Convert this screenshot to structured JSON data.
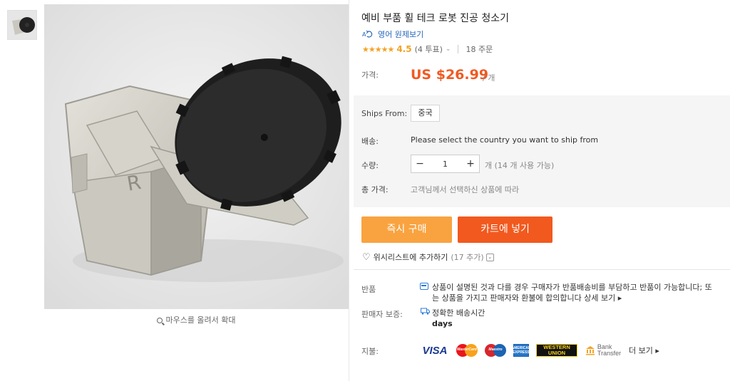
{
  "product": {
    "title": "예비 부품 휠 테크 로봇 진공 청소기",
    "translate_label": "영어 원제보기",
    "rating_value": "4.5",
    "votes": "(4 투표)",
    "orders": "18 주문",
    "zoom_hint": "마우스를 올려서 확대"
  },
  "price": {
    "label": "가격:",
    "value": "US $26.99",
    "unit": "/ 개"
  },
  "options": {
    "ships_from_label": "Ships From:",
    "ships_from_value": "중국",
    "shipping_label": "배송:",
    "shipping_message": "Please select the country you want to ship from",
    "quantity_label": "수량:",
    "quantity_value": "1",
    "quantity_minus": "−",
    "quantity_plus": "+",
    "quantity_note": "개 (14 개 사용 가능)",
    "total_label": "총 가격:",
    "total_note": "고객님께서 선택하신 상품에 따라"
  },
  "actions": {
    "buy_now": "즉시 구매",
    "add_to_cart": "카트에 넣기",
    "wishlist": "위시리스트에 추가하기",
    "wishlist_count": "(17 추가)"
  },
  "returns": {
    "label": "반품",
    "text": "상품이 설명된 것과 다를 경우 구매자가 반품배송비를 부담하고 반품이 가능합니다; 또는 상품을 가지고 판매자와 환불에 합의합니다",
    "more": "상세 보기 ▸"
  },
  "guarantee": {
    "label": "판매자 보증:",
    "text": "정확한 배송시간",
    "days": "days"
  },
  "payment": {
    "label": "지불:",
    "visa": "VISA",
    "mastercard": "MasterCard",
    "maestro": "Maestro",
    "amex": "AMERICAN EXPRESS",
    "western_union": "WESTERN UNION",
    "bank_transfer_1": "Bank",
    "bank_transfer_2": "Transfer",
    "more": "더 보기 ▸"
  },
  "colors": {
    "price": "#f05a22",
    "buy_now": "#f9a340",
    "add_to_cart": "#f2591e",
    "rating": "#f2a325",
    "link": "#2266bb"
  },
  "icons": {
    "translate": "translate-icon",
    "stars": "rating-stars-icon",
    "heart": "heart-icon",
    "zoom": "magnifier-icon",
    "return": "return-policy-icon",
    "guarantee": "delivery-truck-icon"
  }
}
